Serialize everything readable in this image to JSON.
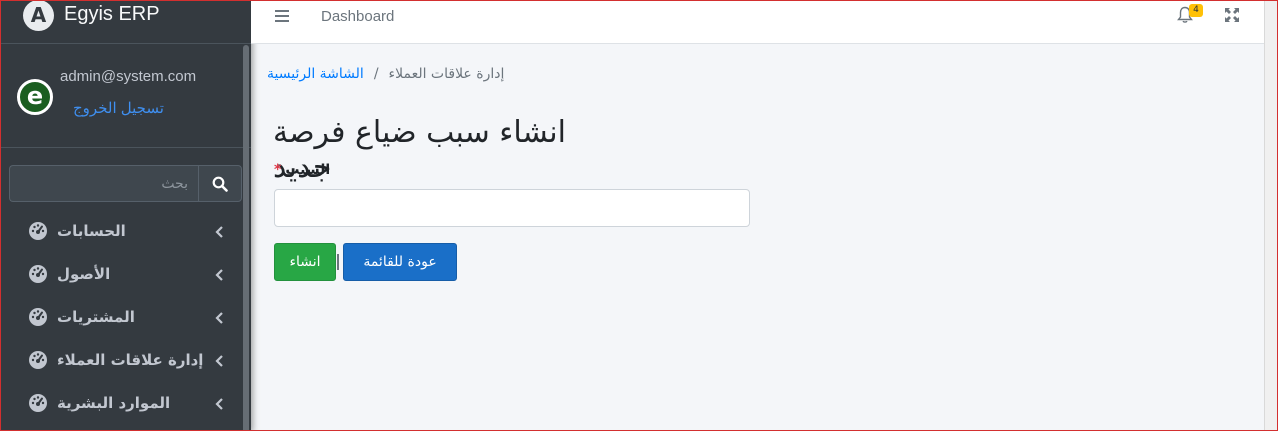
{
  "brand": {
    "logo_letter": "A",
    "name": "Egyis ERP"
  },
  "user": {
    "avatar_letter": "e",
    "email": "admin@system.com",
    "logout_label": "تسجيل الخروج"
  },
  "search": {
    "placeholder": "بحث"
  },
  "nav": {
    "items": [
      {
        "label": "الحسابات",
        "icon": "gauge-icon"
      },
      {
        "label": "الأصول",
        "icon": "gauge-icon"
      },
      {
        "label": "المشتريات",
        "icon": "gauge-icon"
      },
      {
        "label": "إدارة علاقات العملاء",
        "icon": "gauge-icon"
      },
      {
        "label": "الموارد البشرية",
        "icon": "gauge-icon"
      }
    ]
  },
  "topbar": {
    "link": "Dashboard",
    "notification_count": "4"
  },
  "breadcrumb": {
    "home": "الشاشة الرئيسية",
    "current": "إدارة علاقات العملاء",
    "separator": "/"
  },
  "page": {
    "title": "انشاء سبب ضياع فرصة جديد"
  },
  "form": {
    "reason_label": "السبب",
    "required_mark": "*",
    "reason_value": "",
    "create_button": "انشاء",
    "back_button": "عودة للقائمة"
  },
  "colors": {
    "sidebar_bg": "#343a40",
    "primary": "#1a6fc8",
    "success": "#28a745",
    "badge": "#ffc107",
    "link": "#007bff"
  }
}
